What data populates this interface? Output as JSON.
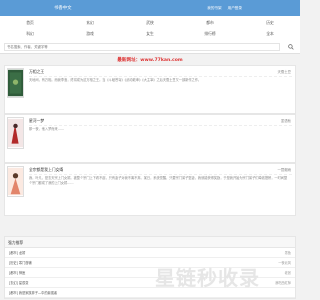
{
  "topbar": {
    "site_name": "书香中文",
    "links": [
      "我的书架",
      "用户登录"
    ]
  },
  "nav": {
    "row1": [
      "首页",
      "玄幻",
      "武侠",
      "都市",
      "历史"
    ],
    "row2": [
      "科幻",
      "游戏",
      "女生",
      "排行榜",
      "全本"
    ]
  },
  "search": {
    "placeholder": "书名搜索、作者、关键字等"
  },
  "promo": "最新网址：www.77kan.com",
  "books": [
    {
      "title": "万相之王",
      "status": "天蚕土豆",
      "desc": "天地间，有万相。而我李洛，终将成为这万相之王。当《斗破苍穹》《武动乾坤》《大主宰》之后天蚕土豆又一部新作之作。"
    },
    {
      "title": "星河一梦",
      "status": "墨语秋",
      "desc": "那一夜，他入梦而来……"
    },
    {
      "title": "全宗都是我上门女婿",
      "status": "一蓑烟雨",
      "desc": "我，叶凡，是玄天宗上门女婿。被整个宗门上下看不起，只有妻子对我不离不弃。某日，系统觉醒，只要宗门弟子娶妻，我就能获得奖励，于是我开始为宗门弟子们牵线搭桥，一时间整个宗门都成了我的上门女婿……"
    }
  ],
  "rec": {
    "title": "强力推荐",
    "items": [
      {
        "title": "[都市] 龙婿",
        "author": "墨鱼"
      },
      {
        "title": "[历史] 寒门首辅",
        "author": "一夜北风"
      },
      {
        "title": "[都市] 神医",
        "author": "老张"
      },
      {
        "title": "[玄幻] 星辰变",
        "author": "我吃西红柿"
      },
      {
        "title": "[都市] 我是家族弃子—中的最强者",
        "author": ""
      }
    ]
  },
  "watermark": "星链秒收录",
  "colors": {
    "topbar": "#5a9bd6",
    "promo": "#dd3333"
  }
}
